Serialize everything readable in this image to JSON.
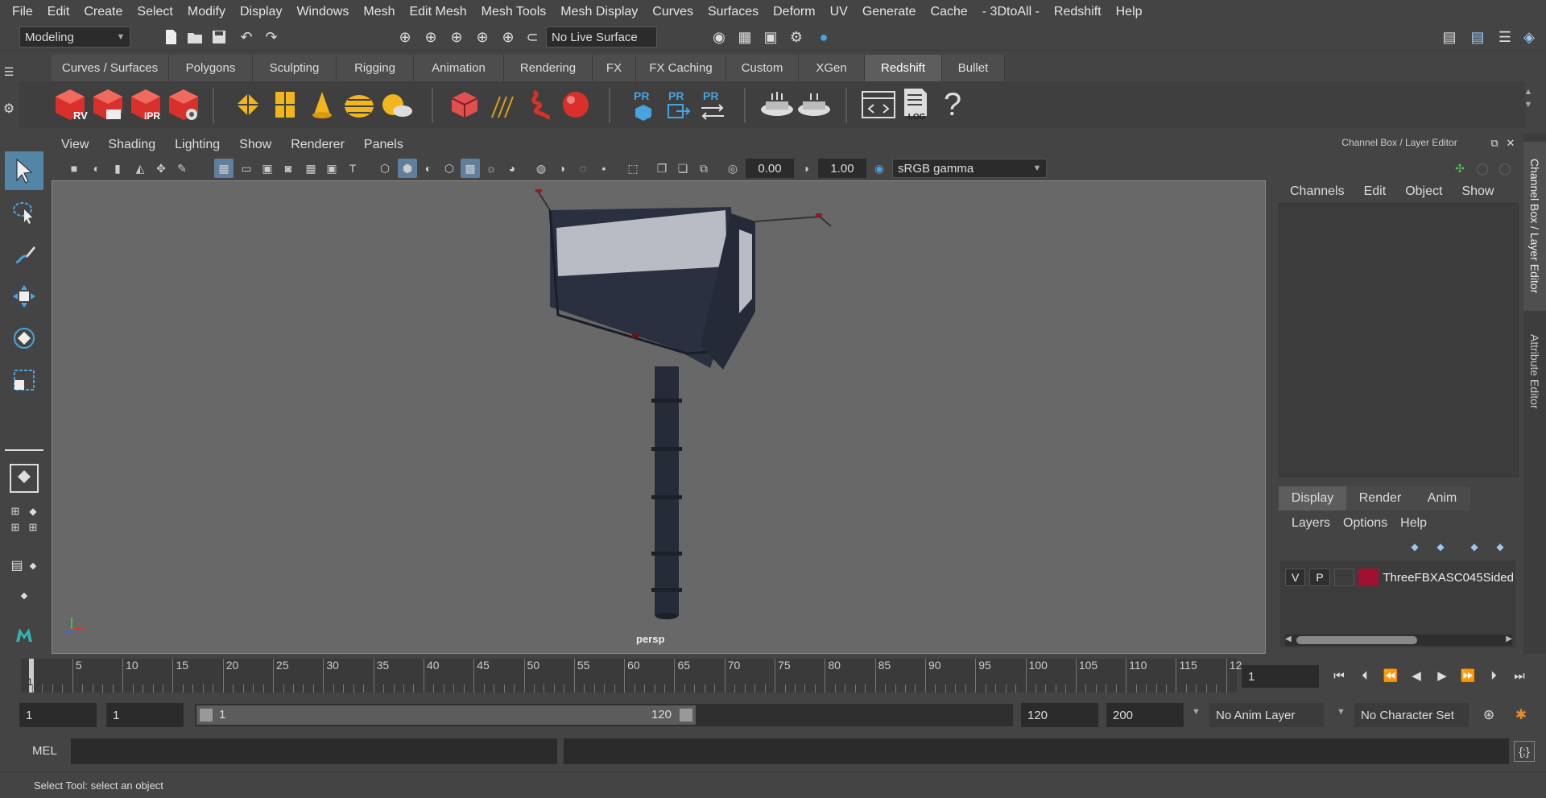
{
  "menubar": [
    "File",
    "Edit",
    "Create",
    "Select",
    "Modify",
    "Display",
    "Windows",
    "Mesh",
    "Edit Mesh",
    "Mesh Tools",
    "Mesh Display",
    "Curves",
    "Surfaces",
    "Deform",
    "UV",
    "Generate",
    "Cache",
    "- 3DtoAll -",
    "Redshift",
    "Help"
  ],
  "status": {
    "mode": "Modeling",
    "live_surface": "No Live Surface"
  },
  "shelf_tabs": [
    "Curves / Surfaces",
    "Polygons",
    "Sculpting",
    "Rigging",
    "Animation",
    "Rendering",
    "FX",
    "FX Caching",
    "Custom",
    "XGen",
    "Redshift",
    "Bullet"
  ],
  "shelf_active": "Redshift",
  "shelf_labels": {
    "rv": "RV",
    "ipr": "IPR",
    "pr": "PR",
    "log": ".LOG",
    "help": "?"
  },
  "viewport": {
    "menu": [
      "View",
      "Shading",
      "Lighting",
      "Show",
      "Renderer",
      "Panels"
    ],
    "exposure": "0.00",
    "gamma": "1.00",
    "colorspace": "sRGB gamma",
    "camera": "persp"
  },
  "channel_box": {
    "title": "Channel Box / Layer Editor",
    "menu": [
      "Channels",
      "Edit",
      "Object",
      "Show"
    ]
  },
  "layer_editor": {
    "tabs": [
      "Display",
      "Render",
      "Anim"
    ],
    "active_tab": "Display",
    "menu": [
      "Layers",
      "Options",
      "Help"
    ],
    "layer": {
      "v": "V",
      "p": "P",
      "name": "ThreeFBXASC045Sided",
      "color": "#a01030"
    }
  },
  "side_tabs": [
    "Channel Box / Layer Editor",
    "Attribute Editor"
  ],
  "timeline": {
    "labels": [
      "5",
      "10",
      "15",
      "20",
      "25",
      "30",
      "35",
      "40",
      "45",
      "50",
      "55",
      "60",
      "65",
      "70",
      "75",
      "80",
      "85",
      "90",
      "95",
      "100",
      "105",
      "110",
      "115",
      "12"
    ],
    "current_frame": "1",
    "current_frame_marker": "1"
  },
  "range": {
    "start": "1",
    "start2": "1",
    "slider_start": "1",
    "slider_end": "120",
    "end": "120",
    "end2": "200",
    "anim_layer": "No Anim Layer",
    "char_set": "No Character Set"
  },
  "command": {
    "lang": "MEL"
  },
  "helpline": "Select Tool: select an object",
  "colors": {
    "accent": "#5285a6",
    "redshift_red": "#d9302c",
    "icon_yellow": "#f2b51c",
    "icon_blue": "#4aa3df"
  }
}
